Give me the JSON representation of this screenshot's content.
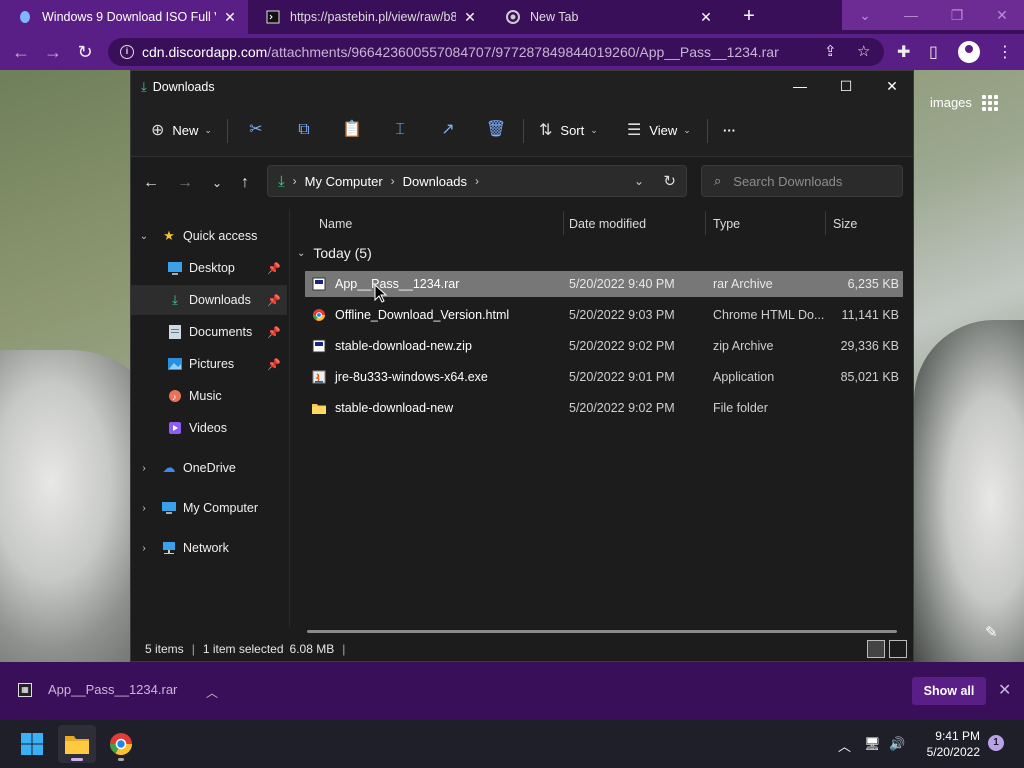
{
  "browser": {
    "tabs": [
      {
        "title": "Windows 9 Download ISO Full Ve",
        "active": true
      },
      {
        "title": "https://pastebin.pl/view/raw/b8(",
        "active": false
      },
      {
        "title": "New Tab",
        "active": false
      }
    ],
    "address": {
      "host": "cdn.discordapp.com",
      "path": "/attachments/966423600557084707/977287849844019260/App__Pass__1234.rar"
    }
  },
  "webpage": {
    "images_label": "images"
  },
  "explorer": {
    "title": "Downloads",
    "toolbar": {
      "new_label": "New",
      "sort_label": "Sort",
      "view_label": "View",
      "more_label": "···"
    },
    "breadcrumb": [
      "My Computer",
      "Downloads"
    ],
    "search_placeholder": "Search Downloads",
    "sidebar": {
      "quick_access": "Quick access",
      "items": [
        {
          "label": "Desktop",
          "pinned": true
        },
        {
          "label": "Downloads",
          "pinned": true,
          "selected": true
        },
        {
          "label": "Documents",
          "pinned": true
        },
        {
          "label": "Pictures",
          "pinned": true
        },
        {
          "label": "Music",
          "pinned": false
        },
        {
          "label": "Videos",
          "pinned": false
        }
      ],
      "onedrive": "OneDrive",
      "my_computer": "My Computer",
      "network": "Network"
    },
    "columns": {
      "name": "Name",
      "date": "Date modified",
      "type": "Type",
      "size": "Size"
    },
    "group": "Today (5)",
    "files": [
      {
        "name": "App__Pass__1234.rar",
        "date": "5/20/2022 9:40 PM",
        "type": "rar Archive",
        "size": "6,235 KB",
        "icon": "rar-icon",
        "selected": true
      },
      {
        "name": "Offline_Download_Version.html",
        "date": "5/20/2022 9:03 PM",
        "type": "Chrome HTML Do...",
        "size": "11,141 KB",
        "icon": "chrome-html-icon",
        "selected": false
      },
      {
        "name": "stable-download-new.zip",
        "date": "5/20/2022 9:02 PM",
        "type": "zip Archive",
        "size": "29,336 KB",
        "icon": "zip-icon",
        "selected": false
      },
      {
        "name": "jre-8u333-windows-x64.exe",
        "date": "5/20/2022 9:01 PM",
        "type": "Application",
        "size": "85,021 KB",
        "icon": "java-exe-icon",
        "selected": false
      },
      {
        "name": "stable-download-new",
        "date": "5/20/2022 9:02 PM",
        "type": "File folder",
        "size": "",
        "icon": "folder-icon",
        "selected": false
      }
    ],
    "status": {
      "items": "5 items",
      "selected": "1 item selected",
      "size": "6.08 MB"
    }
  },
  "download_shelf": {
    "file": "App__Pass__1234.rar",
    "show_all": "Show all"
  },
  "taskbar": {
    "time": "9:41 PM",
    "date": "5/20/2022",
    "notifications": "1"
  },
  "colors": {
    "accent_purple": "#5a1f86",
    "selection_gray": "#777777",
    "download_green": "#3bd18b"
  }
}
